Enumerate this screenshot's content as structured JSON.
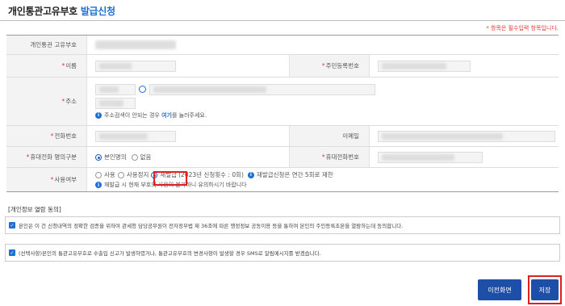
{
  "header": {
    "title_main": "개인통관고유부호",
    "title_accent": "발급신청"
  },
  "required_note": "* 항목은 필수입력 항목입니다.",
  "form": {
    "customs_code_label": "개인통관 고유부호",
    "name_label": "이름",
    "rrn_label": "주민등록번호",
    "address_label": "주소",
    "address_hint_prefix": "주소검색이 안되는 경우",
    "address_hint_link": "여기",
    "address_hint_suffix": "를 눌러주세요.",
    "phone_label": "전화번호",
    "email_label": "이메일",
    "mobile_type_label": "휴대전화 명의구분",
    "mobile_type_options": [
      "본인명의",
      "없음"
    ],
    "mobile_label": "휴대전화번호",
    "reason_label": "사용여부",
    "reason_options": [
      "사용",
      "사용정지",
      "재발급"
    ],
    "reissue_count": "(2023년 신청횟수 : 0회)",
    "reissue_limit": "재발급신청은 연간 5회로 제한",
    "reissue_warning": "재발급 시 현재 부호의 사용이 불가하니 유의하시기 바랍니다"
  },
  "consent": {
    "heading": "[개인정보 열람 동의]",
    "item1": "본인은 이 건 신청내역의 정확한 검증을 위하여 관세청 담당공무원이 전자정부법 제 36조에 따른 행정정보 공동이용 등을 통하여 본인의 주민등록초본을 열람하는데 동의합니다.",
    "item2": "(선택사항)본인의 통관고유부호로 수출입 신고가 발생하였거나, 통관고유부호의 변경사항이 발생할 경우 SMS로 알림메시지를 받겠습니다."
  },
  "buttons": {
    "prev": "이전화면",
    "save": "저장"
  },
  "colors": {
    "accent": "#1e6fd0",
    "button": "#1e4fa8",
    "highlight": "#e02020",
    "required": "#e53935"
  }
}
